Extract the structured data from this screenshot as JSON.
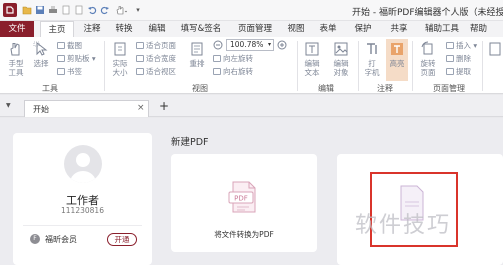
{
  "window": {
    "title": "开始 - 福昕PDF编辑器个人版（未经授权的产品"
  },
  "ribbon_tabs": [
    "文件",
    "主页",
    "注释",
    "转换",
    "编辑",
    "填写&签名",
    "页面管理",
    "视图",
    "表单",
    "保护",
    "共享",
    "辅助工具",
    "帮助"
  ],
  "ribbon": {
    "hand_tool": "手型\n工具",
    "select": "选择",
    "screenshot": "截图",
    "clipboard": "剪贴板",
    "bookmark": "书签",
    "actual_size": "实际\n大小",
    "fit_page": "适合页面",
    "fit_width": "适合宽度",
    "fit_visible": "适合视区",
    "reflow": "重排",
    "zoom_value": "100.78%",
    "rotate_left": "向左旋转",
    "rotate_right": "向右旋转",
    "edit_text": "编辑\n文本",
    "edit_object": "编辑\n对象",
    "typewriter": "打\n字机",
    "highlight": "高亮",
    "rotate_page": "旋转\n页面",
    "insert": "插入",
    "delete": "删除",
    "extract": "提取",
    "groups": {
      "tools": "工具",
      "view": "视图",
      "edit": "编辑",
      "comment": "注释",
      "page_mgmt": "页面管理"
    }
  },
  "doc_tab": {
    "label": "开始",
    "close": "×",
    "new": "+"
  },
  "user": {
    "name": "工作者",
    "id": "111230816",
    "member_label": "福昕会员",
    "activate": "开通"
  },
  "new_pdf": {
    "section_title": "新建PDF",
    "convert_label": "将文件转换为PDF",
    "pdf_badge": "PDF"
  },
  "watermark": "软件技巧"
}
